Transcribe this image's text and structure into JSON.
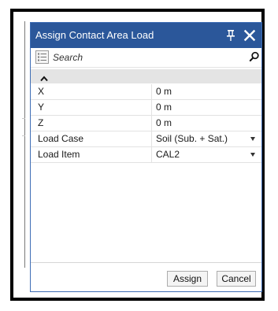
{
  "panel": {
    "title": "Assign Contact Area Load",
    "pin_icon": "pin-icon",
    "close_icon": "close-icon",
    "accent_color": "#2b579a"
  },
  "search": {
    "placeholder": "Search",
    "categorize_icon": "categorized-list-icon",
    "search_icon": "magnifier-icon"
  },
  "group": {
    "toggle_icon": "chevron-up-icon"
  },
  "properties": [
    {
      "name": "X",
      "value": "0 m"
    },
    {
      "name": "Y",
      "value": "0 m"
    },
    {
      "name": "Z",
      "value": "0 m"
    },
    {
      "name": "Load Case",
      "value": "Soil (Sub. + Sat.)",
      "dropdown": true
    },
    {
      "name": "Load Item",
      "value": "CAL2",
      "dropdown": true
    }
  ],
  "buttons": {
    "assign": "Assign",
    "cancel": "Cancel"
  }
}
